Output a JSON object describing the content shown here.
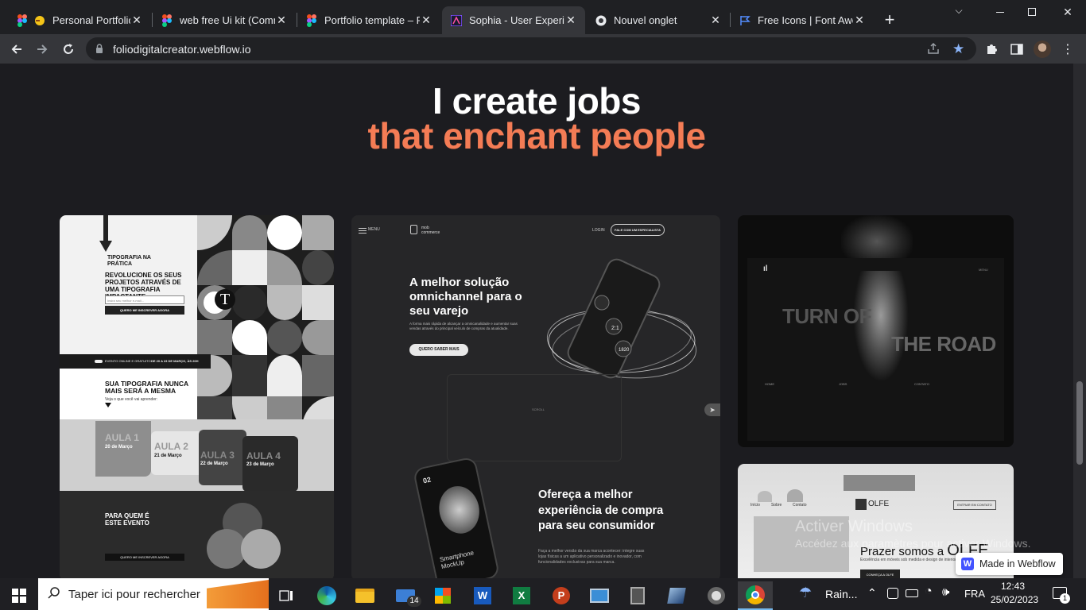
{
  "tabs": [
    {
      "label": "Personal Portfolio",
      "icon": "figma-icon"
    },
    {
      "label": "web free Ui kit (Comm",
      "icon": "figma-icon"
    },
    {
      "label": "Portfolio template – Fi",
      "icon": "figma-icon"
    },
    {
      "label": "Sophia - User Experien",
      "icon": "webflow-site-icon"
    },
    {
      "label": "Nouvel onglet",
      "icon": "chrome-icon"
    },
    {
      "label": "Free Icons | Font Awe",
      "icon": "flag-icon"
    }
  ],
  "url": "foliodigitalcreator.webflow.io",
  "heading": {
    "line1": "I create jobs",
    "line2": "that enchant people"
  },
  "colors": {
    "accent": "#f47c55",
    "page_bg": "#1c1c20"
  },
  "card1": {
    "badge": "TIPOGRAFIA NA PRÁTICA",
    "headline": "REVOLUCIONE OS SEUS PROJETOS ATRAVÉS DE UMA TIPOGRAFIA IMPACTANTE",
    "input_placeholder": "Insira seu melhor e-mail...",
    "cta": "QUERO ME INSCREVER AGORA",
    "band_left": "EVENTO ONLINE E GRATUITO",
    "band_right": "DE 20 A 23 DE MARÇO, ÀS 20H",
    "section_title": "SUA TIPOGRAFIA NUNCA MAIS SERÁ A MESMA",
    "section_sub": "Veja o que você vai aprender:",
    "glyph": "T",
    "lessons": [
      {
        "title": "AULA 1",
        "date": "20 de Março"
      },
      {
        "title": "AULA 2",
        "date": "21 de Março"
      },
      {
        "title": "AULA 3",
        "date": "22 de Março"
      },
      {
        "title": "AULA 4",
        "date": "23 de Março"
      }
    ],
    "bottom_title": "PARA QUEM É ESTE EVENTO",
    "bottom_cta": "QUERO ME INSCREVER AGORA"
  },
  "card2": {
    "menu": "MENU",
    "brand": "mob commerce",
    "login": "LOGIN",
    "cta_top": "FALE COM UM ESPECIALISTA",
    "headline": "A melhor solução omnichannel para o seu varejo",
    "sub": "A forma mais rápida de alcançar a omnicanalidade e aumentar suas vendas através do principal veículo de compras da atualidade.",
    "cta": "QUERO SABER MAIS",
    "scroll": "SCROLL",
    "phone_values": [
      "2:1",
      "1820"
    ],
    "number": "02",
    "mockup_title": "Smartphone MockUp",
    "offer_title": "Ofereça a melhor experiência de compra para seu consumidor",
    "offer_text": "Faça a melhor versão da sua marca acontecer: integre suas lojas físicas a um aplicativo personalizado e inovador, com funcionalidades exclusivas para sua marca."
  },
  "card3": {
    "menu": "MENU",
    "title_left": "TURN OF",
    "title_right": "THE ROAD",
    "cols": [
      "HOME",
      "JOBS",
      "CONTATO"
    ]
  },
  "card4": {
    "nav": [
      "Início",
      "Sobre",
      "Contato"
    ],
    "brand": "OLFE",
    "cta": "ENTRAR EM CONTATO",
    "headline": "Prazer somos a",
    "headline_brand": "OLFE",
    "sub": "Excelência em móveis sob medida e design de interiores",
    "btn": "CONHEÇA A OLFE"
  },
  "watermark": {
    "title": "Activer Windows",
    "sub": "Accédez aux paramètres pour activer Windows."
  },
  "webflow_badge": "Made in Webflow",
  "taskbar": {
    "search_placeholder": "Taper ici pour rechercher",
    "mail_badge": "14",
    "weather": "Rain...",
    "lang": "FRA",
    "time": "12:43",
    "date": "25/02/2023",
    "notif_count": "1"
  }
}
